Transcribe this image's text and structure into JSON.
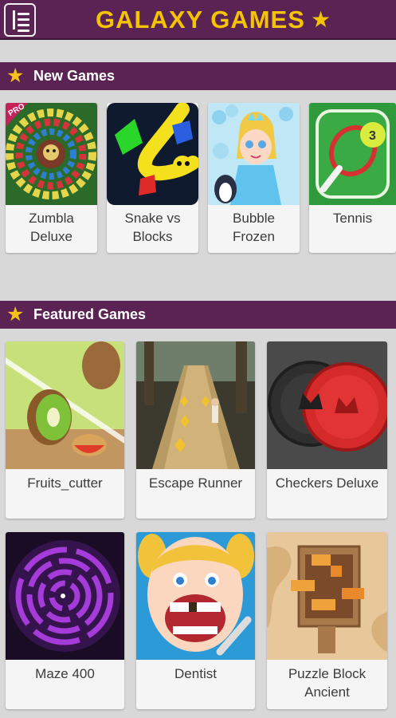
{
  "header": {
    "title": "GALAXY GAMES",
    "menu_icon": "menu-book-icon",
    "star_icon": "star-icon"
  },
  "new_games": {
    "title": "New Games",
    "items": [
      {
        "name": "Zumbla Deluxe",
        "line1": "Zumbla",
        "line2": "Deluxe",
        "badge": "PRO"
      },
      {
        "name": "Snake vs Blocks",
        "line1": "Snake vs",
        "line2": "Blocks"
      },
      {
        "name": "Bubble Frozen",
        "line1": "Bubble",
        "line2": "Frozen"
      },
      {
        "name": "Tennis",
        "line1": "Tennis",
        "line2": "",
        "ball_number": "3"
      }
    ]
  },
  "featured_games": {
    "title": "Featured Games",
    "items": [
      {
        "line1": "Fruits_cutter",
        "line2": ""
      },
      {
        "line1": "Escape Runner",
        "line2": ""
      },
      {
        "line1": "Checkers Deluxe",
        "line2": ""
      },
      {
        "line1": "Maze 400",
        "line2": ""
      },
      {
        "line1": "Dentist",
        "line2": ""
      },
      {
        "line1": "Puzzle Block",
        "line2": "Ancient"
      }
    ]
  },
  "colors": {
    "header_bg": "#5a2353",
    "title_yellow": "#f5c400",
    "page_bg": "#d8d8d8",
    "card_bg": "#f5f5f5"
  }
}
